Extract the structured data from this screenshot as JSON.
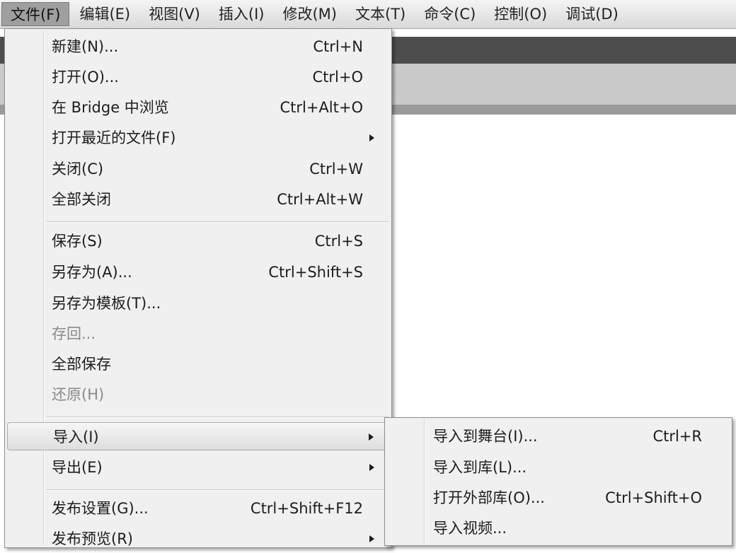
{
  "menubar": {
    "items": [
      {
        "label": "文件(F)"
      },
      {
        "label": "编辑(E)"
      },
      {
        "label": "视图(V)"
      },
      {
        "label": "插入(I)"
      },
      {
        "label": "修改(M)"
      },
      {
        "label": "文本(T)"
      },
      {
        "label": "命令(C)"
      },
      {
        "label": "控制(O)"
      },
      {
        "label": "调试(D)"
      }
    ]
  },
  "file_menu": {
    "items": [
      {
        "label": "新建(N)...",
        "shortcut": "Ctrl+N"
      },
      {
        "label": "打开(O)...",
        "shortcut": "Ctrl+O"
      },
      {
        "label": "在 Bridge 中浏览",
        "shortcut": "Ctrl+Alt+O"
      },
      {
        "label": "打开最近的文件(F)",
        "shortcut": ""
      },
      {
        "label": "关闭(C)",
        "shortcut": "Ctrl+W"
      },
      {
        "label": "全部关闭",
        "shortcut": "Ctrl+Alt+W"
      },
      {
        "label": "保存(S)",
        "shortcut": "Ctrl+S"
      },
      {
        "label": "另存为(A)...",
        "shortcut": "Ctrl+Shift+S"
      },
      {
        "label": "另存为模板(T)...",
        "shortcut": ""
      },
      {
        "label": "存回...",
        "shortcut": ""
      },
      {
        "label": "全部保存",
        "shortcut": ""
      },
      {
        "label": "还原(H)",
        "shortcut": ""
      },
      {
        "label": "导入(I)",
        "shortcut": ""
      },
      {
        "label": "导出(E)",
        "shortcut": ""
      },
      {
        "label": "发布设置(G)...",
        "shortcut": "Ctrl+Shift+F12"
      },
      {
        "label": "发布预览(R)",
        "shortcut": ""
      }
    ]
  },
  "import_submenu": {
    "items": [
      {
        "label": "导入到舞台(I)...",
        "shortcut": "Ctrl+R"
      },
      {
        "label": "导入到库(L)...",
        "shortcut": ""
      },
      {
        "label": "打开外部库(O)...",
        "shortcut": "Ctrl+Shift+O"
      },
      {
        "label": "导入视频...",
        "shortcut": ""
      }
    ]
  }
}
